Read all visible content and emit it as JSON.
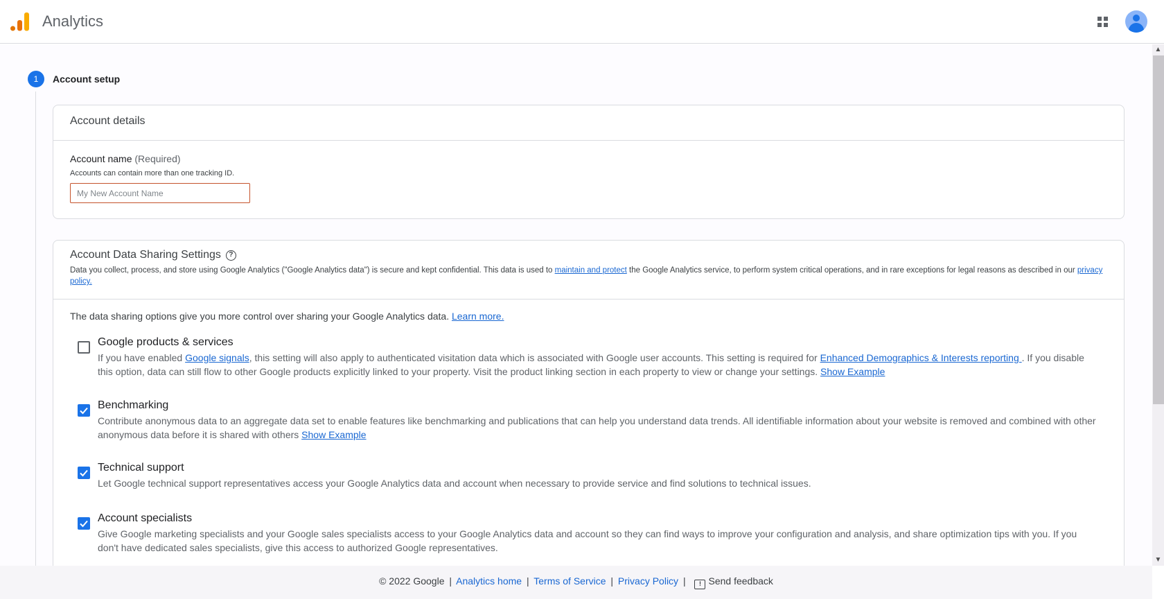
{
  "header": {
    "app_title": "Analytics",
    "logo_colors": [
      "#e37400",
      "#e8710a",
      "#f9ab00"
    ],
    "apps_icon": "apps-grid-icon",
    "avatar_icon": "account-circle-icon"
  },
  "stepper": {
    "step_number": "1",
    "step_label": "Account setup",
    "accent_color": "#1a73e8"
  },
  "account_details": {
    "title": "Account details",
    "field_label": "Account name",
    "field_required": "(Required)",
    "field_hint": "Accounts can contain more than one tracking ID.",
    "input_value": "",
    "input_placeholder": "My New Account Name"
  },
  "sharing": {
    "title": "Account Data Sharing Settings",
    "help_icon": "help-circle-icon",
    "desc_part1": "Data you collect, process, and store using Google Analytics (\"Google Analytics data\") is secure and kept confidential. This data is used to ",
    "desc_link1": "maintain and protect",
    "desc_part2": " the Google Analytics service, to perform system critical operations, and in rare exceptions for legal reasons as described in our ",
    "desc_link2": "privacy policy.",
    "intro_text": "The data sharing options give you more control over sharing your Google Analytics data. ",
    "intro_link": "Learn more.",
    "options": [
      {
        "title": "Google products & services",
        "checked": false,
        "desc_part1": "If you have enabled ",
        "desc_link1": "Google signals",
        "desc_part2": ", this setting will also apply to authenticated visitation data which is associated with Google user accounts. This setting is required for ",
        "desc_link2": "Enhanced Demographics & Interests reporting ",
        "desc_part3": ". If you disable this option, data can still flow to other Google products explicitly linked to your property. Visit the product linking section in each property to view or change your settings.  ",
        "show_example": "Show Example"
      },
      {
        "title": "Benchmarking",
        "checked": true,
        "desc": "Contribute anonymous data to an aggregate data set to enable features like benchmarking and publications that can help you understand data trends. All identifiable information about your website is removed and combined with other anonymous data before it is shared with others  ",
        "show_example": "Show Example"
      },
      {
        "title": "Technical support",
        "checked": true,
        "desc": "Let Google technical support representatives access your Google Analytics data and account when necessary to provide service and find solutions to technical issues."
      },
      {
        "title": "Account specialists",
        "checked": true,
        "desc": "Give Google marketing specialists and your Google sales specialists access to your Google Analytics data and account so they can find ways to improve your configuration and analysis, and share optimization tips with you. If you don't have dedicated sales specialists, give this access to authorized Google representatives."
      }
    ]
  },
  "footer": {
    "copyright": "© 2022 Google",
    "sep": "|",
    "links": [
      "Analytics home",
      "Terms of Service",
      "Privacy Policy"
    ],
    "feedback_label": "Send feedback",
    "feedback_icon": "feedback-icon"
  }
}
